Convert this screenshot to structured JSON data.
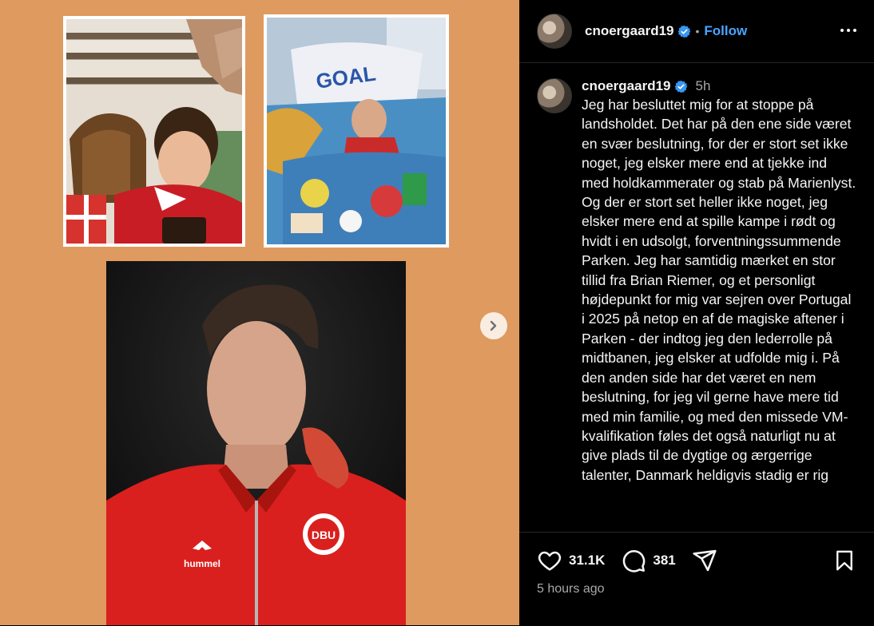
{
  "post": {
    "username": "cnoergaard19",
    "follow_label": "Follow",
    "separator": "•",
    "caption_time": "5h",
    "caption": "Jeg har besluttet mig for at stoppe på landsholdet. Det har på den ene side været en svær beslutning, for der er stort set ikke noget, jeg elsker mere end at tjekke ind med holdkammerater og stab på Marienlyst. Og der er stort set heller ikke noget, jeg elsker mere end at spille kampe i rødt og hvidt i en udsolgt, forventningssummende Parken. Jeg har samtidig mærket en stor tillid fra Brian Riemer, og et personligt højdepunkt for mig var sejren over Portugal i 2025 på netop en af de magiske aftener i Parken - der indtog jeg den lederrolle på midtbanen, jeg elsker at udfolde mig i. På den anden side har det været en nem beslutning, for jeg vil gerne have mere tid med min familie, og med den missede VM-kvalifikation føles det også naturligt nu at give plads til de dygtige og ærgerrige talenter, Danmark heldigvis stadig er rig",
    "likes": "31.1K",
    "comments": "381",
    "posted_ago": "5 hours ago"
  },
  "media": {
    "background": "#df9a5f",
    "photo3_text": {
      "brand": "hummel",
      "crest": "DBU"
    }
  },
  "icons": [
    "verified-badge-icon",
    "more-options-icon",
    "heart-icon",
    "comment-icon",
    "share-icon",
    "bookmark-icon",
    "chevron-right-icon"
  ],
  "colors": {
    "follow": "#4aa4ff",
    "panel_bg": "#000000",
    "verified": "#3897f0",
    "shirt_red": "#d9201e"
  }
}
